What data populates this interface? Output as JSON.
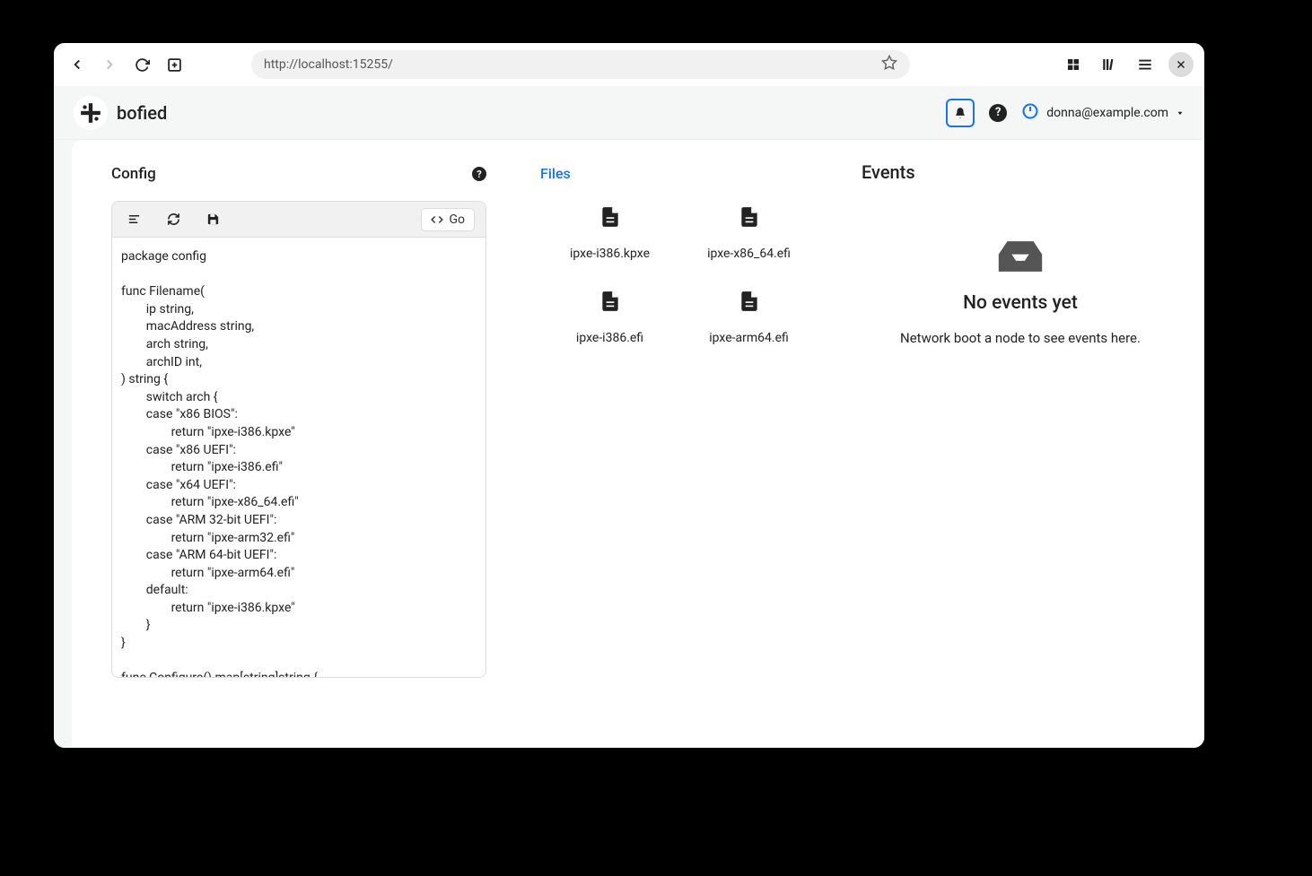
{
  "browser": {
    "url": "http://localhost:15255/"
  },
  "app": {
    "title": "bofied",
    "user_email": "donna@example.com"
  },
  "config": {
    "title": "Config",
    "language": "Go",
    "code": "package config\n\nfunc Filename(\n        ip string,\n        macAddress string,\n        arch string,\n        archID int,\n) string {\n        switch arch {\n        case \"x86 BIOS\":\n                return \"ipxe-i386.kpxe\"\n        case \"x86 UEFI\":\n                return \"ipxe-i386.efi\"\n        case \"x64 UEFI\":\n                return \"ipxe-x86_64.efi\"\n        case \"ARM 32-bit UEFI\":\n                return \"ipxe-arm32.efi\"\n        case \"ARM 64-bit UEFI\":\n                return \"ipxe-arm64.efi\"\n        default:\n                return \"ipxe-i386.kpxe\"\n        }\n}\n\nfunc Configure() map[string]string {"
  },
  "files": {
    "title": "Files",
    "items": [
      {
        "name": "ipxe-i386.kpxe"
      },
      {
        "name": "ipxe-x86_64.efi"
      },
      {
        "name": "ipxe-i386.efi"
      },
      {
        "name": "ipxe-arm64.efi"
      }
    ]
  },
  "events": {
    "title": "Events",
    "empty_title": "No events yet",
    "empty_text": "Network boot a node to see events here."
  }
}
